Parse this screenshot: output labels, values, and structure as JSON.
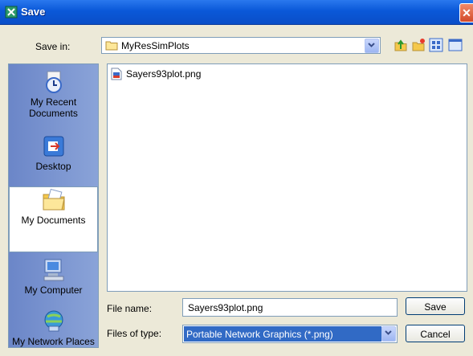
{
  "window": {
    "title": "Save"
  },
  "toolbar": {
    "save_in_label": "Save in:",
    "save_in_value": "MyResSimPlots"
  },
  "places": [
    {
      "label": "My Recent Documents",
      "icon": "recent-documents-icon"
    },
    {
      "label": "Desktop",
      "icon": "desktop-icon"
    },
    {
      "label": "My Documents",
      "icon": "my-documents-icon",
      "selected": true
    },
    {
      "label": "My Computer",
      "icon": "my-computer-icon"
    },
    {
      "label": "My Network Places",
      "icon": "network-places-icon"
    }
  ],
  "files": [
    {
      "name": "Sayers93plot.png",
      "icon": "png-file-icon"
    }
  ],
  "form": {
    "file_name_label": "File name:",
    "file_name_value": "Sayers93plot.png",
    "file_type_label": "Files of type:",
    "file_type_value": "Portable Network Graphics (*.png)"
  },
  "buttons": {
    "save": "Save",
    "cancel": "Cancel"
  },
  "colors": {
    "titlebar": "#0a58d8",
    "places_bar": "#7a94d0",
    "selection": "#316ac5"
  }
}
